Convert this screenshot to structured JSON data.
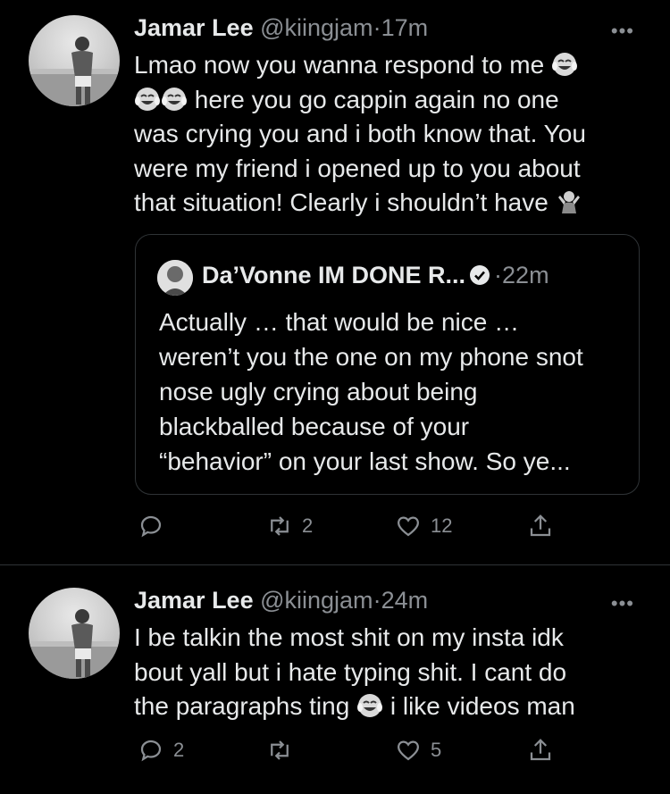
{
  "tweets": [
    {
      "name": "Jamar Lee",
      "handle": "@kiingjam",
      "dot": "·",
      "time": "17m",
      "more": "•••",
      "text_lines": [
        "Lmao now you wanna respond to me",
        "here you go cappin again no one",
        "was crying you and i both know that. You",
        "were my friend i opened up to you about",
        "that situation! Clearly i shouldn’t have"
      ],
      "quote": {
        "name": "Da’Vonne IM DONE R...",
        "dot": "·",
        "time": "22m",
        "text_lines": [
          "Actually … that would be nice …",
          "weren’t you the one on my phone snot",
          "nose ugly crying about being",
          "blackballed because of your",
          "“behavior” on your last show. So ye..."
        ]
      },
      "actions": {
        "replies": "",
        "retweets": "2",
        "likes": "12"
      }
    },
    {
      "name": "Jamar Lee",
      "handle": "@kiingjam",
      "dot": "·",
      "time": "24m",
      "more": "•••",
      "text_lines": [
        "I be talkin the most shit on my insta idk",
        "bout yall but i hate typing shit. I cant do",
        "the paragraphs ting",
        "i like videos man"
      ],
      "actions": {
        "replies": "2",
        "retweets": "",
        "likes": "5"
      }
    }
  ],
  "icons": {
    "reply": "reply-icon",
    "retweet": "retweet-icon",
    "like": "heart-icon",
    "share": "share-icon",
    "emoji_laugh": "face-with-tears-of-joy-icon",
    "emoji_shrug": "person-shrugging-icon",
    "verified": "verified-badge-icon"
  },
  "colors": {
    "background": "#000000",
    "text": "#e7e9ea",
    "muted": "#8b8f94",
    "border": "#2f3336"
  }
}
